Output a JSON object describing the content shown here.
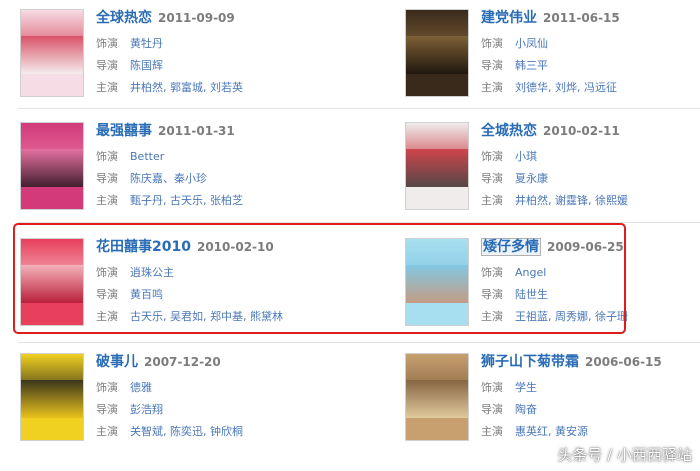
{
  "labels": {
    "actor": "饰演",
    "director": "导演",
    "cast": "主演"
  },
  "movies": [
    {
      "title": "全球热恋",
      "date": "2011-09-09",
      "role": "黄牡丹",
      "director": "陈国辉",
      "cast": "井柏然, 郭富城, 刘若英",
      "poster_colors": [
        "#f6dce4",
        "#d43a52",
        "#f4f0ef"
      ]
    },
    {
      "title": "建党伟业",
      "date": "2011-06-15",
      "role": "小凤仙",
      "director": "韩三平",
      "cast": "刘德华, 刘烨, 冯远征",
      "poster_colors": [
        "#3a2a1c",
        "#8a6a3a",
        "#1c140c"
      ]
    },
    {
      "title": "最强囍事",
      "date": "2011-01-31",
      "role": "Better",
      "director": "陈庆嘉、秦小珍",
      "cast": "甄子丹, 古天乐, 张柏芝",
      "poster_colors": [
        "#d23a7a",
        "#e87aa6",
        "#2a1a22"
      ]
    },
    {
      "title": "全城热恋",
      "date": "2010-02-11",
      "role": "小琪",
      "director": "夏永康",
      "cast": "井柏然, 谢霆锋, 徐熙媛",
      "poster_colors": [
        "#f0ecec",
        "#c82830",
        "#3a2a2a"
      ]
    },
    {
      "title": "花田囍事2010",
      "date": "2010-02-10",
      "role": "逍珠公主",
      "director": "黄百鸣",
      "cast": "古天乐, 吴君如, 郑中基, 熊黛林",
      "poster_colors": [
        "#e8405c",
        "#f6c6cc",
        "#b01a34"
      ]
    },
    {
      "title": "矮仔多情",
      "date": "2009-06-25",
      "role": "Angel",
      "director": "陆世生",
      "cast": "王祖蓝, 周秀娜, 徐子珊",
      "poster_colors": [
        "#a8dff0",
        "#7cc4e0",
        "#c89070"
      ]
    },
    {
      "title": "破事儿",
      "date": "2007-12-20",
      "role": "德雅",
      "director": "彭浩翔",
      "cast": "关智斌, 陈奕迅, 钟欣桐",
      "poster_colors": [
        "#f0d020",
        "#1a1a1a",
        "#e8c01c"
      ]
    },
    {
      "title": "狮子山下菊带霜",
      "date": "2006-06-15",
      "role": "学生",
      "director": "陶奋",
      "cast": "惠英红, 黄安源",
      "poster_colors": [
        "#c8a070",
        "#7a5a3a",
        "#e6d2a4"
      ]
    }
  ],
  "watermark": "头条号 / 小西西驿站"
}
